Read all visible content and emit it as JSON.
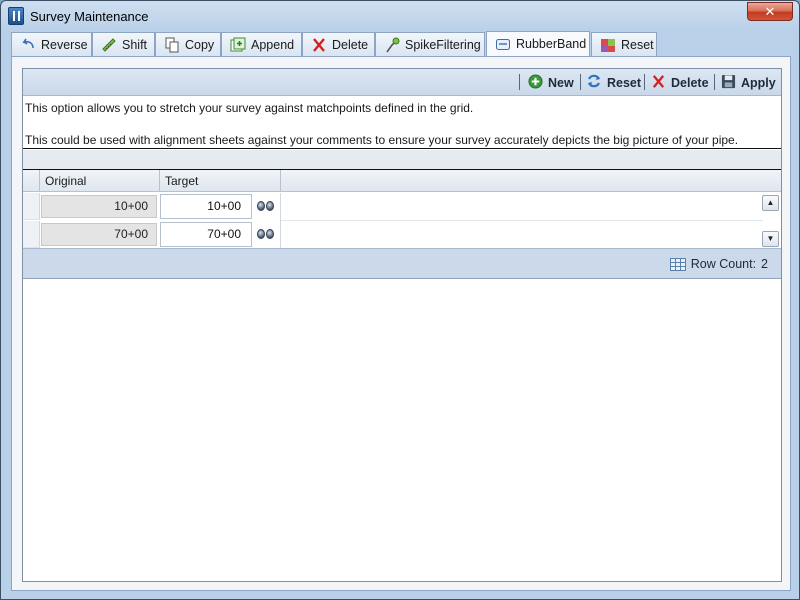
{
  "window": {
    "title": "Survey Maintenance",
    "close_glyph": "✕"
  },
  "tabs": [
    {
      "label": "Reverse",
      "icon": "reverse-arrow-icon"
    },
    {
      "label": "Shift",
      "icon": "shift-ruler-icon"
    },
    {
      "label": "Copy",
      "icon": "copy-icon"
    },
    {
      "label": "Append",
      "icon": "append-icon"
    },
    {
      "label": "Delete",
      "icon": "delete-x-icon"
    },
    {
      "label": "SpikeFiltering",
      "icon": "spike-filter-icon"
    },
    {
      "label": "RubberBand",
      "icon": "rubberband-icon",
      "active": true
    },
    {
      "label": "Reset",
      "icon": "reset-icon"
    }
  ],
  "toolbar": {
    "new_label": "New",
    "reset_label": "Reset",
    "delete_label": "Delete",
    "apply_label": "Apply"
  },
  "description": {
    "line1": "This option allows you to stretch your survey against matchpoints defined in the grid.",
    "line2": "This could be used with alignment sheets against your comments to ensure your survey accurately depicts the big picture of your pipe."
  },
  "grid": {
    "columns": [
      "Original",
      "Target"
    ],
    "rows": [
      {
        "original": "10+00",
        "target": "10+00"
      },
      {
        "original": "70+00",
        "target": "70+00"
      }
    ]
  },
  "footer": {
    "row_count_label": "Row Count:",
    "row_count_value": "2"
  },
  "colors": {
    "window_frame": "#b9d0e9",
    "toolbar": "#c9d8ea",
    "close_button": "#c23b20",
    "new_icon": "#3a9a3a",
    "delete_icon": "#d42020"
  }
}
